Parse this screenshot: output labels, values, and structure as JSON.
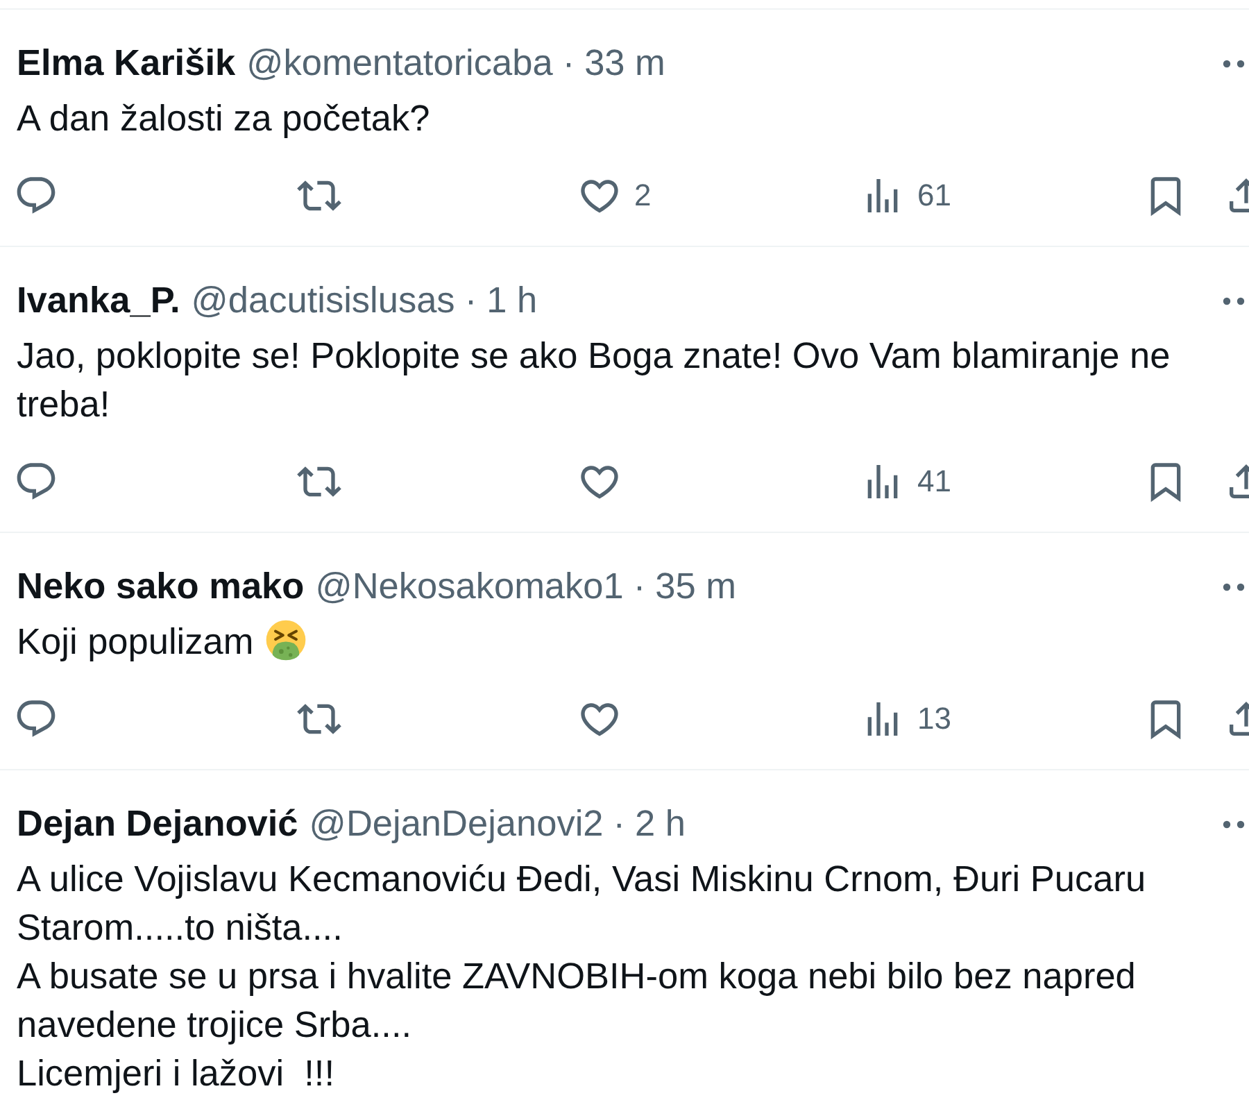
{
  "tweets": [
    {
      "name": "Elma Karišik",
      "handle": "@komentatoricaba",
      "separator": "·",
      "time": "33 m",
      "text": "A dan žalosti za početak?",
      "actions": {
        "likes": "2",
        "views": "61"
      }
    },
    {
      "name": "Ivanka_P.",
      "handle": "@dacutisislusas",
      "separator": "·",
      "time": "1 h",
      "text": "Jao, poklopite se! Poklopite se ako Boga znate! Ovo Vam blamiranje ne treba!",
      "actions": {
        "views": "41"
      }
    },
    {
      "name": "Neko sako mako",
      "handle": "@Nekosakomako1",
      "separator": "·",
      "time": "35 m",
      "text": "Koji populizam",
      "emoji_after_text": true,
      "actions": {
        "views": "13"
      }
    },
    {
      "name": "Dejan Dejanović",
      "handle": "@DejanDejanovi2",
      "separator": "·",
      "time": "2 h",
      "text": "A ulice Vojislavu Kecmanoviću Đedi, Vasi Miskinu Crnom, Đuri Pucaru Starom.....to ništa....\nA busate se u prsa i hvalite ZAVNOBIH-om koga nebi bilo bez napred navedene trojice Srba....\nLicemjeri i lažovi  !!!"
    }
  ]
}
